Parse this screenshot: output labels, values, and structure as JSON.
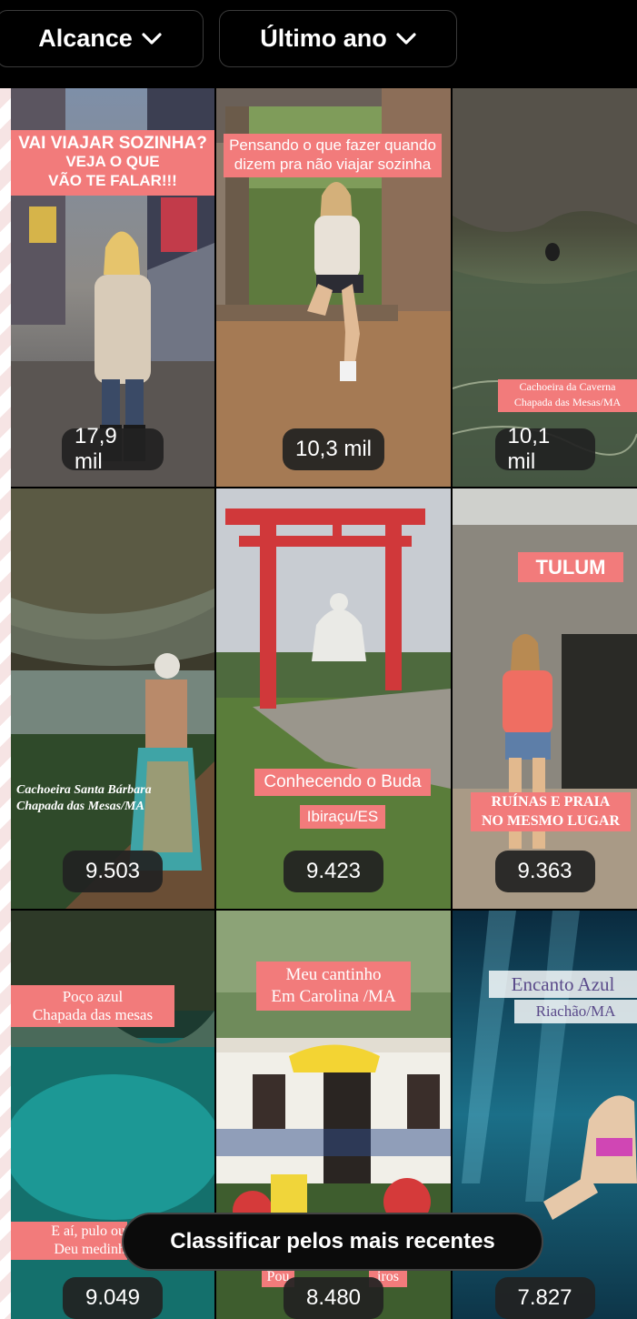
{
  "filters": {
    "reach_label": "Alcance",
    "period_label": "Último ano"
  },
  "tiles": [
    {
      "captions": [
        "VAI VIAJAR SOZINHA?",
        "VEJA O QUE",
        "VÃO TE FALAR!!!"
      ],
      "count": "17,9 mil"
    },
    {
      "captions": [
        "Pensando o que fazer quando",
        "dizem pra não viajar sozinha"
      ],
      "count": "10,3 mil"
    },
    {
      "captions": [
        "Cachoeira da Caverna",
        "Chapada das Mesas/MA"
      ],
      "count": "10,1 mil"
    },
    {
      "captions": [
        "Cachoeira Santa Bárbara",
        "Chapada das Mesas/MA"
      ],
      "count": "9.503"
    },
    {
      "captions": [
        "Conhecendo o Buda",
        "Ibiraçu/ES"
      ],
      "count": "9.423"
    },
    {
      "captions": [
        "TULUM",
        "RUÍNAS E PRAIA",
        "NO MESMO LUGAR"
      ],
      "count": "9.363"
    },
    {
      "captions": [
        "Poço azul",
        "Chapada das mesas",
        "E aí, pulo ou",
        "Deu medinh"
      ],
      "count": "9.049"
    },
    {
      "captions": [
        "Meu cantinho",
        "Em Carolina /MA",
        "Pou",
        "iros"
      ],
      "count": "8.480"
    },
    {
      "captions": [
        "Encanto Azul",
        "Riachão/MA"
      ],
      "count": "7.827"
    }
  ],
  "toast": {
    "label": "Classificar pelos mais recentes"
  },
  "colors": {
    "caption_bg": "#f27b7b",
    "badge_bg": "#222222",
    "background": "#000000"
  }
}
